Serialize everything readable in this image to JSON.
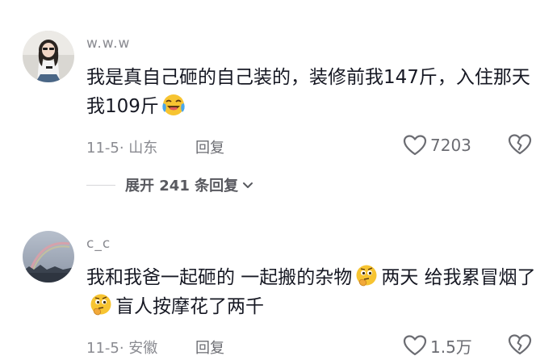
{
  "comments": [
    {
      "username": "w.w.w",
      "text_before_emoji": "我是真自己砸的自己装的，装修前我147斤，入住那天我109斤",
      "emoji_1": "crying-laughing-emoji",
      "text_after_emoji": "",
      "date_location": "11-5· 山东",
      "reply_label": "回复",
      "like_count": "7203",
      "expand_label": "展开 241 条回复"
    },
    {
      "username": "c_c",
      "text_part_1": "我和我爸一起砸的 一起搬的杂物",
      "emoji_1": "thinking-emoji",
      "text_part_2": "两天 给我累冒烟了",
      "emoji_2": "thinking-emoji",
      "text_part_3": "盲人按摩花了两千",
      "date_location": "11-5· 安徽",
      "reply_label": "回复",
      "like_count": "1.5万"
    }
  ],
  "colors": {
    "primary_text": "#161823",
    "secondary_text": "#8a8b91",
    "action_text": "#6b6c72"
  },
  "icons": {
    "like": "heart-outline-icon",
    "dislike": "broken-heart-outline-icon",
    "expand": "chevron-down-icon"
  }
}
